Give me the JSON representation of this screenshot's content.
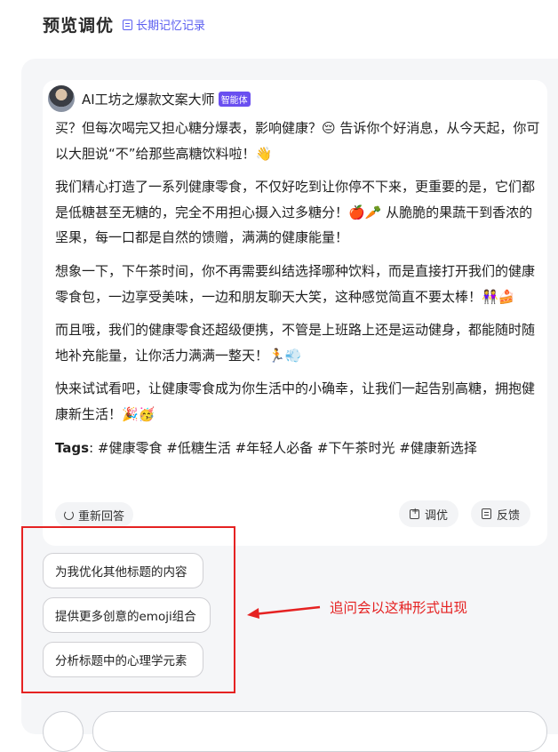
{
  "header": {
    "title": "预览调优",
    "memory_link": "长期记忆记录"
  },
  "agent": {
    "name": "AI工坊之爆款文案大师",
    "badge": "智能体"
  },
  "content": {
    "paragraphs": [
      "买？但每次喝完又担心糖分爆表，影响健康？😔 告诉你个好消息，从今天起，你可以大胆说“不”给那些高糖饮料啦！👋",
      "我们精心打造了一系列健康零食，不仅好吃到让你停不下来，更重要的是，它们都是低糖甚至无糖的，完全不用担心摄入过多糖分！🍎🥕 从脆脆的果蔬干到香浓的坚果，每一口都是自然的馈赠，满满的健康能量！",
      "想象一下，下午茶时间，你不再需要纠结选择哪种饮料，而是直接打开我们的健康零食包，一边享受美味，一边和朋友聊天大笑，这种感觉简直不要太棒！👭🍰",
      "而且哦，我们的健康零食还超级便携，不管是上班路上还是运动健身，都能随时随地补充能量，让你活力满满一整天！🏃💨",
      "快来试试看吧，让健康零食成为你生活中的小确幸，让我们一起告别高糖，拥抱健康新生活！🎉🥳"
    ],
    "tags_label": "Tags",
    "tags_value": ": #健康零食 #低糖生活 #年轻人必备 #下午茶时光 #健康新选择"
  },
  "actions": {
    "regenerate": "重新回答",
    "tune": "调优",
    "feedback": "反馈"
  },
  "suggestions": [
    "为我优化其他标题的内容",
    "提供更多创意的emoji组合",
    "分析标题中的心理学元素"
  ],
  "annotation": {
    "text": "追问会以这种形式出现",
    "color": "#e52222"
  },
  "colors": {
    "accent": "#5b5ef0",
    "badge": "#6a4ff0",
    "panel_bg": "#f5f6f8"
  }
}
